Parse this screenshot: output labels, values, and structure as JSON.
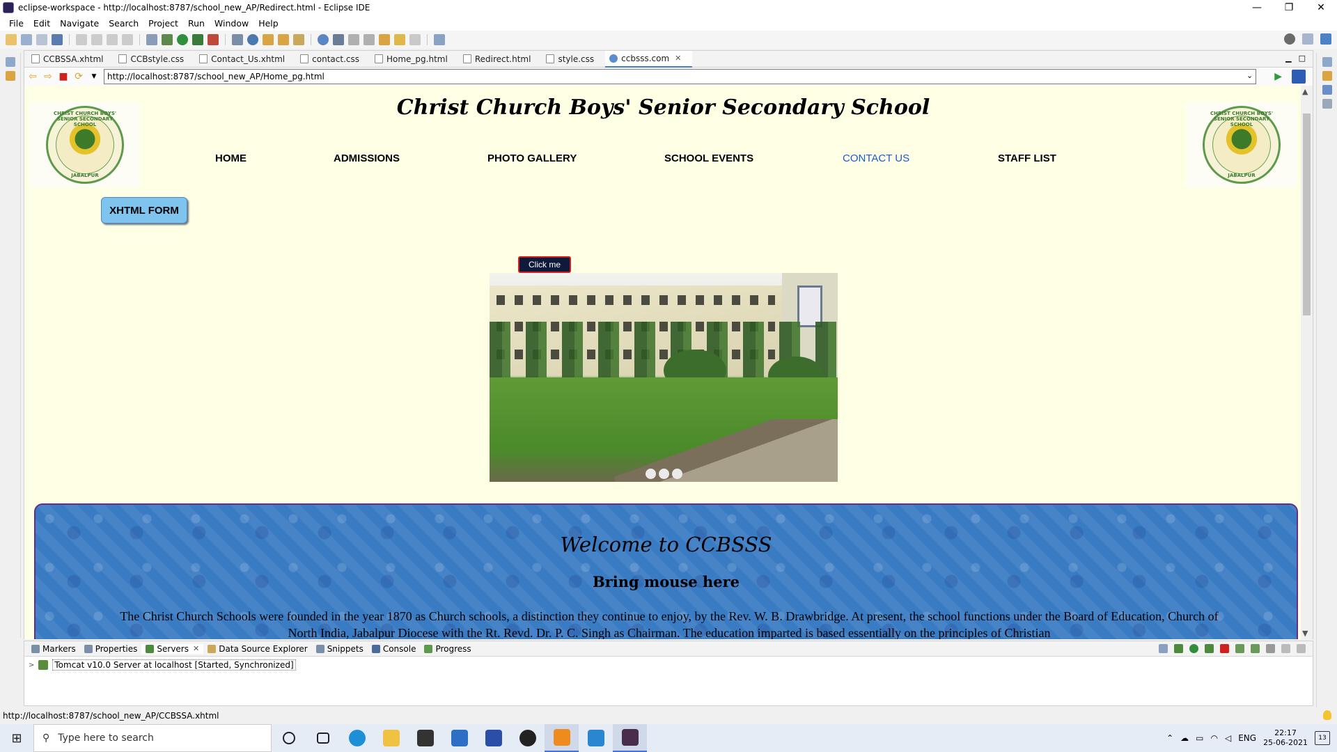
{
  "window": {
    "title": "eclipse-workspace - http://localhost:8787/school_new_AP/Redirect.html - Eclipse IDE",
    "controls": [
      "—",
      "❐",
      "✕"
    ]
  },
  "menubar": [
    "File",
    "Edit",
    "Navigate",
    "Search",
    "Project",
    "Run",
    "Window",
    "Help"
  ],
  "editor_tabs": [
    {
      "label": "CCBSSA.xhtml"
    },
    {
      "label": "CCBstyle.css"
    },
    {
      "label": "Contact_Us.xhtml"
    },
    {
      "label": "contact.css"
    },
    {
      "label": "Home_pg.html"
    },
    {
      "label": "Redirect.html"
    },
    {
      "label": "style.css"
    },
    {
      "label": "ccbsss.com",
      "active": true,
      "close": "✕"
    }
  ],
  "browser": {
    "url": "http://localhost:8787/school_new_AP/Home_pg.html"
  },
  "site": {
    "title": "Christ Church Boys' Senior Secondary School",
    "logo_text_top": "CHRIST CHURCH BOYS' SENIOR SECONDARY SCHOOL",
    "logo_text_bottom": "JABALPUR",
    "nav": [
      {
        "label": "HOME"
      },
      {
        "label": "ADMISSIONS"
      },
      {
        "label": "PHOTO GALLERY"
      },
      {
        "label": "SCHOOL EVENTS"
      },
      {
        "label": "CONTACT US",
        "current": true
      },
      {
        "label": "STAFF LIST"
      }
    ],
    "xhtml_button": "XHTML FORM",
    "click_button": "Click me",
    "slideshow": {
      "slides": 3,
      "current": 1
    },
    "welcome": {
      "heading": "Welcome to CCBSSS",
      "subheading": "Bring mouse here",
      "paragraph": "The Christ Church Schools were founded in the year 1870 as Church schools, a distinction they continue to enjoy, by the Rev. W. B. Drawbridge. At present, the school functions under the Board of Education, Church of North India, Jabalpur Diocese with the Rt. Revd. Dr. P. C. Singh as Chairman. The education imparted is based essentially on the principles of Christian"
    }
  },
  "bottom_panel": {
    "tabs": [
      {
        "label": "Markers"
      },
      {
        "label": "Properties"
      },
      {
        "label": "Servers",
        "active": true,
        "close": "✕"
      },
      {
        "label": "Data Source Explorer"
      },
      {
        "label": "Snippets"
      },
      {
        "label": "Console"
      },
      {
        "label": "Progress"
      }
    ],
    "server_entry": "Tomcat v10.0 Server at localhost  [Started, Synchronized]"
  },
  "statusbar": {
    "text": "http://localhost:8787/school_new_AP/CCBSSA.xhtml"
  },
  "taskbar": {
    "search_placeholder": "Type here to search",
    "language": "ENG",
    "time": "22:17",
    "date": "25-06-2021",
    "notifications": "13"
  },
  "colors": {
    "page_bg": "#ffffe6",
    "nav_current": "#1a5bc4",
    "welcome_bg": "#3a7cc4",
    "xhtml_btn": "#7fc3ef",
    "click_btn_bg": "#0f1a3a",
    "click_btn_border": "#d12020"
  }
}
